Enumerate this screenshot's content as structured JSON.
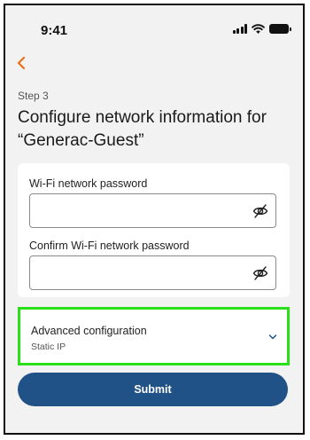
{
  "status_bar": {
    "time": "9:41"
  },
  "step_label": "Step 3",
  "title": "Configure network information for “Generac-Guest”",
  "password_field": {
    "label": "Wi-Fi network password",
    "value": "",
    "placeholder": ""
  },
  "confirm_field": {
    "label": "Confirm Wi-Fi network password",
    "value": "",
    "placeholder": ""
  },
  "advanced": {
    "title": "Advanced configuration",
    "subtitle": "Static IP"
  },
  "submit_label": "Submit",
  "colors": {
    "accent_back": "#e8701a",
    "primary_button": "#215287",
    "highlight": "#29e01b",
    "chevron": "#215287"
  },
  "icons": {
    "back": "chevron-left-icon",
    "password_visibility": "eye-off-icon",
    "expand": "chevron-down-icon"
  }
}
